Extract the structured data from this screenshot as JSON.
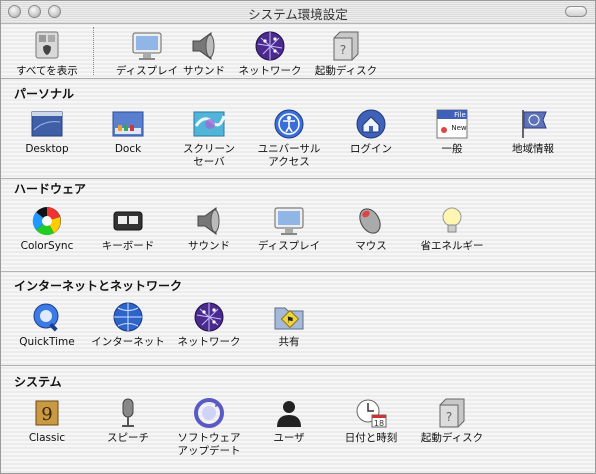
{
  "window": {
    "title": "システム環境設定"
  },
  "toolbar": {
    "items": [
      {
        "label": "すべてを表示",
        "icon": "show-all-icon"
      },
      {
        "label": "ディスプレイ",
        "icon": "display-icon"
      },
      {
        "label": "サウンド",
        "icon": "speaker-icon"
      },
      {
        "label": "ネットワーク",
        "icon": "network-globe-icon"
      },
      {
        "label": "起動ディスク",
        "icon": "hard-disk-icon"
      }
    ]
  },
  "sections": [
    {
      "title": "パーソナル",
      "items": [
        {
          "label": "Desktop",
          "icon": "desktop-icon"
        },
        {
          "label": "Dock",
          "icon": "dock-icon"
        },
        {
          "label": "スクリーン\nセーバ",
          "icon": "screensaver-icon"
        },
        {
          "label": "ユニバーサル\nアクセス",
          "icon": "universal-access-icon"
        },
        {
          "label": "ログイン",
          "icon": "login-house-icon"
        },
        {
          "label": "一般",
          "icon": "general-file-new-icon"
        },
        {
          "label": "地域情報",
          "icon": "flag-globe-icon"
        }
      ]
    },
    {
      "title": "ハードウェア",
      "items": [
        {
          "label": "ColorSync",
          "icon": "colorsync-icon"
        },
        {
          "label": "キーボード",
          "icon": "keyboard-icon"
        },
        {
          "label": "サウンド",
          "icon": "speaker-icon"
        },
        {
          "label": "ディスプレイ",
          "icon": "display-icon"
        },
        {
          "label": "マウス",
          "icon": "mouse-icon"
        },
        {
          "label": "省エネルギー",
          "icon": "lightbulb-icon"
        }
      ]
    },
    {
      "title": "インターネットとネットワーク",
      "items": [
        {
          "label": "QuickTime",
          "icon": "quicktime-icon"
        },
        {
          "label": "インターネット",
          "icon": "internet-icon"
        },
        {
          "label": "ネットワーク",
          "icon": "network-globe-icon"
        },
        {
          "label": "共有",
          "icon": "sharing-folder-icon"
        }
      ]
    },
    {
      "title": "システム",
      "items": [
        {
          "label": "Classic",
          "icon": "classic-icon"
        },
        {
          "label": "スピーチ",
          "icon": "microphone-icon"
        },
        {
          "label": "ソフトウェア\nアップデート",
          "icon": "software-update-icon"
        },
        {
          "label": "ユーザ",
          "icon": "user-silhouette-icon"
        },
        {
          "label": "日付と時刻",
          "icon": "clock-calendar-icon"
        },
        {
          "label": "起動ディスク",
          "icon": "hard-disk-icon"
        }
      ]
    }
  ]
}
